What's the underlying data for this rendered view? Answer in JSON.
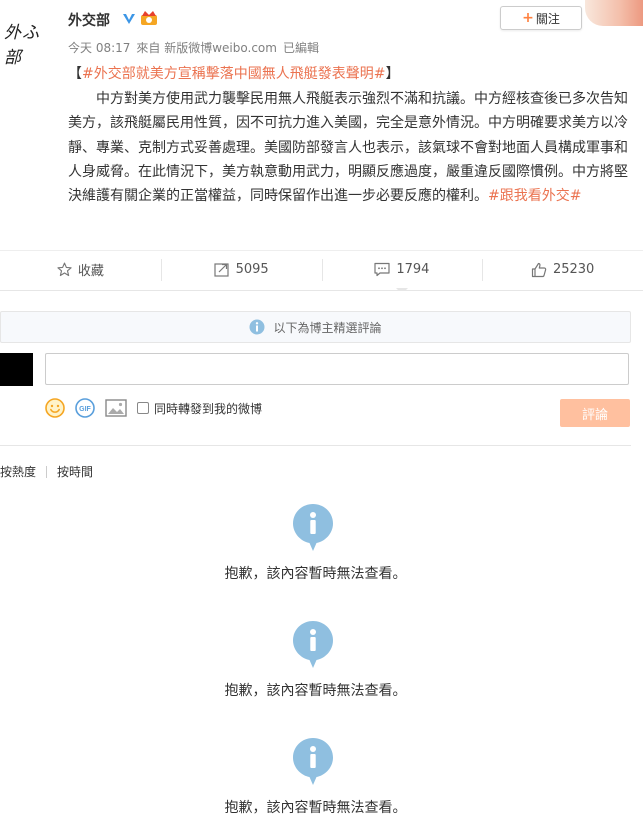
{
  "post": {
    "avatar_text": "外ふ部",
    "username": "外交部",
    "follow_label": "關注",
    "time": "今天 08:17",
    "source": "來自 新版微博weibo.com",
    "edited": "已編輯",
    "title_open": "【",
    "title_tag": "#外交部就美方宣稱擊落中國無人飛艇發表聲明#",
    "title_close": "】",
    "body": "中方對美方使用武力襲擊民用無人飛艇表示強烈不滿和抗議。中方經核查後已多次告知美方，該飛艇屬民用性質，因不可抗力進入美國，完全是意外情況。中方明確要求美方以冷靜、專業、克制方式妥善處理。美國防部發言人也表示，該氣球不會對地面人員構成軍事和人身威脅。在此情況下，美方執意動用武力，明顯反應過度，嚴重違反國際慣例。中方將堅決維護有關企業的正當權益，同時保留作出進一步必要反應的權利。",
    "body_tag": "#跟我看外交#"
  },
  "actions": {
    "favorite_label": "收藏",
    "repost_count": "5095",
    "comment_count": "1794",
    "like_count": "25230"
  },
  "comments": {
    "notice": "以下為博主精選評論",
    "input_placeholder": "",
    "repost_checkbox_label": "同時轉發到我的微博",
    "submit_label": "評論",
    "sort_hot": "按熱度",
    "sort_time": "按時間",
    "unavailable": [
      {
        "msg": "抱歉，該內容暫時無法查看。"
      },
      {
        "msg": "抱歉，該內容暫時無法查看。"
      },
      {
        "msg": "抱歉，該內容暫時無法查看。"
      }
    ]
  },
  "colors": {
    "accent": "#eb7350",
    "info_icon": "#8fbfe0",
    "submit_disabled": "#ffc09f",
    "verified": "#3c96e6"
  }
}
